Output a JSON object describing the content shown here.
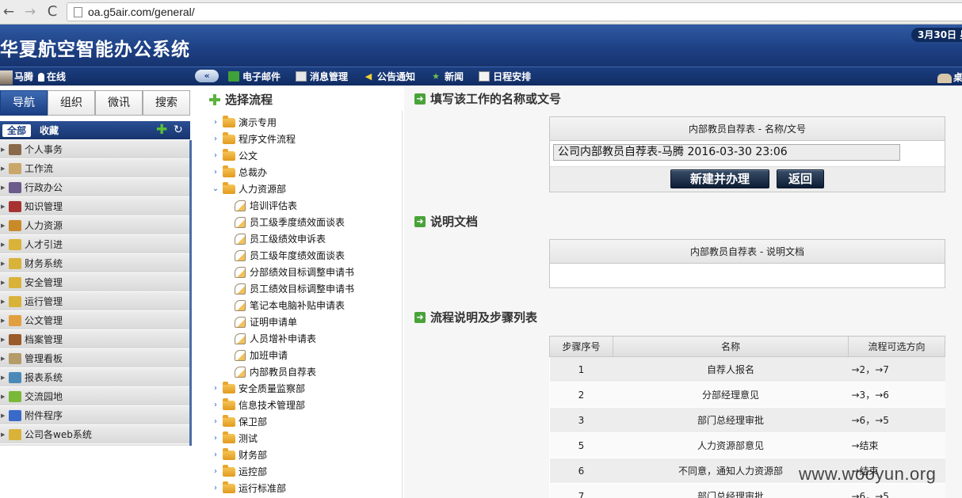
{
  "browser": {
    "url": "oa.g5air.com/general/",
    "back_glyph": "←",
    "forward_glyph": "→",
    "reload_glyph": "C"
  },
  "header": {
    "title": "华夏航空智能办公系统",
    "date": "3月30日 星"
  },
  "menubar": {
    "user_name": "马腾",
    "user_status": "在线",
    "collapse_glyph": "«",
    "items": [
      {
        "label": "电子邮件",
        "icon": "email-icon"
      },
      {
        "label": "消息管理",
        "icon": "message-icon"
      },
      {
        "label": "公告通知",
        "icon": "announcement-icon"
      },
      {
        "label": "新闻",
        "icon": "news-icon"
      },
      {
        "label": "日程安排",
        "icon": "calendar-icon"
      }
    ],
    "right_label": "桌"
  },
  "left_nav": {
    "tabs": [
      "导航",
      "组织",
      "微讯",
      "搜索"
    ],
    "sub_tabs": {
      "all": "全部",
      "favorites": "收藏"
    },
    "items": [
      {
        "label": "个人事务",
        "color": "#8a6a4a"
      },
      {
        "label": "工作流",
        "color": "#c9a76b"
      },
      {
        "label": "行政办公",
        "color": "#6b5a8a"
      },
      {
        "label": "知识管理",
        "color": "#a83232"
      },
      {
        "label": "人力资源",
        "color": "#c98a2a"
      },
      {
        "label": "人才引进",
        "color": "#d9b23a"
      },
      {
        "label": "财务系统",
        "color": "#d9b23a"
      },
      {
        "label": "安全管理",
        "color": "#d9b23a"
      },
      {
        "label": "运行管理",
        "color": "#d9b23a"
      },
      {
        "label": "公文管理",
        "color": "#e0a040"
      },
      {
        "label": "档案管理",
        "color": "#9a5a2a"
      },
      {
        "label": "管理看板",
        "color": "#b59a6a"
      },
      {
        "label": "报表系统",
        "color": "#4a8ab8"
      },
      {
        "label": "交流园地",
        "color": "#7ab83a"
      },
      {
        "label": "附件程序",
        "color": "#3a6ac9"
      },
      {
        "label": "公司各web系统",
        "color": "#d9b23a"
      }
    ]
  },
  "tree": {
    "title": "选择流程",
    "items": [
      {
        "label": "演示专用",
        "kind": "folder",
        "expanded": false
      },
      {
        "label": "程序文件流程",
        "kind": "folder",
        "expanded": false
      },
      {
        "label": "公文",
        "kind": "folder",
        "expanded": false
      },
      {
        "label": "总裁办",
        "kind": "folder",
        "expanded": false
      },
      {
        "label": "人力资源部",
        "kind": "folder",
        "expanded": true
      },
      {
        "label": "培训评估表",
        "kind": "doc"
      },
      {
        "label": "员工级季度绩效面谈表",
        "kind": "doc"
      },
      {
        "label": "员工级绩效申诉表",
        "kind": "doc"
      },
      {
        "label": "员工级年度绩效面谈表",
        "kind": "doc"
      },
      {
        "label": "分部绩效目标调整申请书",
        "kind": "doc"
      },
      {
        "label": "员工绩效目标调整申请书",
        "kind": "doc"
      },
      {
        "label": "笔记本电脑补贴申请表",
        "kind": "doc"
      },
      {
        "label": "证明申请单",
        "kind": "doc"
      },
      {
        "label": "人员增补申请表",
        "kind": "doc"
      },
      {
        "label": "加班申请",
        "kind": "doc"
      },
      {
        "label": "内部教员自荐表",
        "kind": "doc"
      },
      {
        "label": "安全质量监察部",
        "kind": "folder",
        "expanded": false
      },
      {
        "label": "信息技术管理部",
        "kind": "folder",
        "expanded": false
      },
      {
        "label": "保卫部",
        "kind": "folder",
        "expanded": false
      },
      {
        "label": "测试",
        "kind": "folder",
        "expanded": false
      },
      {
        "label": "财务部",
        "kind": "folder",
        "expanded": false
      },
      {
        "label": "运控部",
        "kind": "folder",
        "expanded": false
      },
      {
        "label": "运行标准部",
        "kind": "folder",
        "expanded": false
      }
    ]
  },
  "main": {
    "section1": {
      "title": "填写该工作的名称或文号",
      "box_header": "内部教员自荐表 - 名称/文号",
      "name_value": "公司内部教员自荐表-马腾 2016-03-30 23:06",
      "create_button": "新建并办理",
      "back_button": "返回"
    },
    "section2": {
      "title": "说明文档",
      "box_header": "内部教员自荐表 - 说明文档"
    },
    "section3": {
      "title": "流程说明及步骤列表",
      "columns": [
        "步骤序号",
        "名称",
        "流程可选方向"
      ],
      "rows": [
        {
          "step": "1",
          "name": "自荐人报名",
          "direction": "→2，→7"
        },
        {
          "step": "2",
          "name": "分部经理意见",
          "direction": "→3，→6"
        },
        {
          "step": "3",
          "name": "部门总经理审批",
          "direction": "→6，→5"
        },
        {
          "step": "5",
          "name": "人力资源部意见",
          "direction": "→结束"
        },
        {
          "step": "6",
          "name": "不同意，通知人力资源部",
          "direction": "→结束"
        },
        {
          "step": "7",
          "name": "部门总经理审批",
          "direction": "→6，→5"
        }
      ]
    }
  },
  "watermark": "www.wooyun.org"
}
